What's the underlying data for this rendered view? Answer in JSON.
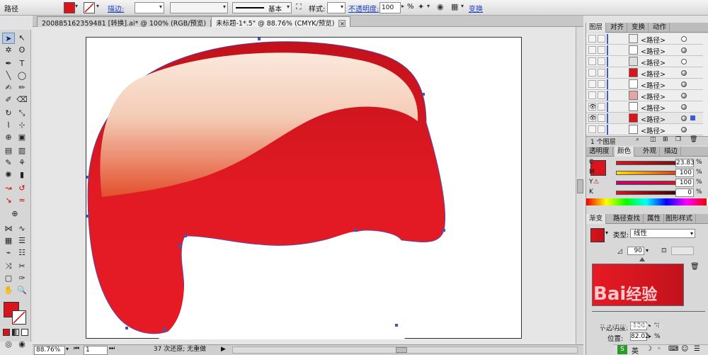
{
  "control_bar": {
    "object_type": "路径",
    "stroke_link": "描边:",
    "stroke_style": "基本",
    "style_label": "样式:",
    "opacity_link": "不透明度:",
    "opacity_value": "100",
    "opacity_unit": "%",
    "transform_link": "变换",
    "fill_color": "#d9141c"
  },
  "tabs": [
    {
      "label": "200885162359481 [转换].ai* @ 100% (RGB/预览)"
    },
    {
      "label": "未标题-1*.5\" @ 88.76% (CMYK/预览)"
    }
  ],
  "status": {
    "zoom": "88.76%",
    "page": "1",
    "message": "37 次还原; 无重做"
  },
  "layers_panel": {
    "tabs": [
      "图层",
      "对齐",
      "变换",
      "动作"
    ],
    "rows": [
      {
        "label": "<路径>",
        "visible": "",
        "target": "empty"
      },
      {
        "label": "<路径>",
        "visible": "",
        "target": "filled"
      },
      {
        "label": "<路径>",
        "visible": "",
        "target": "empty"
      },
      {
        "label": "<路径>",
        "visible": "",
        "target": "filled"
      },
      {
        "label": "<路径>",
        "visible": "",
        "target": "filled"
      },
      {
        "label": "<路径>",
        "visible": "",
        "target": "filled"
      },
      {
        "label": "<路径>",
        "visible": "👁",
        "target": "filled"
      },
      {
        "label": "<路径>",
        "visible": "👁",
        "target": "selected"
      },
      {
        "label": "<路径>",
        "visible": "",
        "target": "filled"
      }
    ],
    "footer": "1 个图层"
  },
  "color_panel": {
    "tabs": [
      "透明度",
      "颜色",
      "外观",
      "描边"
    ],
    "channels": [
      {
        "name": "C",
        "value": "23.83",
        "color": "#00a0e0"
      },
      {
        "name": "M",
        "value": "100",
        "color": "#e0007a"
      },
      {
        "name": "Y",
        "value": "100",
        "color": "#f0e000"
      },
      {
        "name": "K",
        "value": "0",
        "color": "#000000"
      }
    ],
    "unit": "%"
  },
  "gradient_panel": {
    "tabs": [
      "渐变",
      "路径查找",
      "属性",
      "图形样式"
    ],
    "type_label": "类型:",
    "type_value": "线性",
    "angle": "90",
    "opacity_label": "不透明度:",
    "opacity_value": "100",
    "location_label": "位置:",
    "location_value": "82.02",
    "unit": "%"
  },
  "watermark": {
    "text1": "Bai",
    "text2": "经验",
    "text3": "jingyan.baidu.com"
  },
  "taskbar": {
    "ime": "英"
  }
}
